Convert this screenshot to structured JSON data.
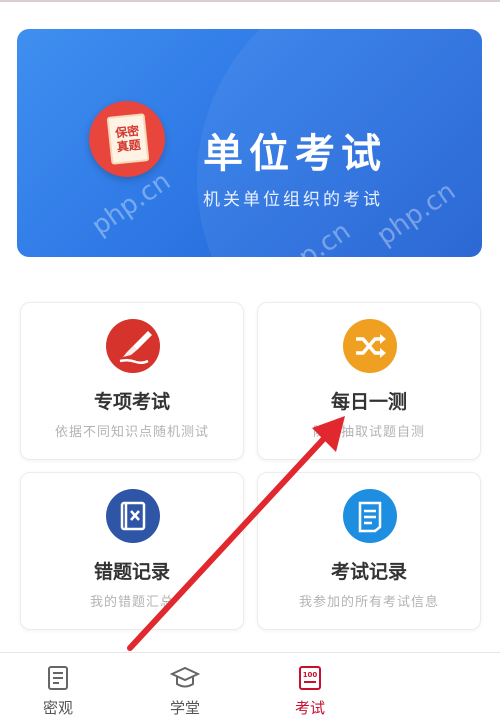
{
  "banner": {
    "badge_text": "保密\n真题",
    "title": "单位考试",
    "subtitle": "机关单位组织的考试",
    "watermark": "php.cn"
  },
  "cards": [
    {
      "title": "专项考试",
      "desc": "依据不同知识点随机测试",
      "icon": "pencil-icon",
      "color": "#d6332d"
    },
    {
      "title": "每日一测",
      "desc": "随机抽取试题自测",
      "icon": "shuffle-icon",
      "color": "#f0a020"
    },
    {
      "title": "错题记录",
      "desc": "我的错题汇总",
      "icon": "wrong-book-icon",
      "color": "#2e55a6"
    },
    {
      "title": "考试记录",
      "desc": "我参加的所有考试信息",
      "icon": "document-icon",
      "color": "#1e8fe0"
    }
  ],
  "tabbar": [
    {
      "label": "密观",
      "icon": "news-icon",
      "active": false
    },
    {
      "label": "学堂",
      "icon": "graduation-cap-icon",
      "active": false
    },
    {
      "label": "考试",
      "icon": "exam-icon",
      "active": true
    }
  ],
  "colors": {
    "accent": "#c8102e",
    "banner_blue": "#2f79e6",
    "arrow_red": "#e0282e"
  }
}
